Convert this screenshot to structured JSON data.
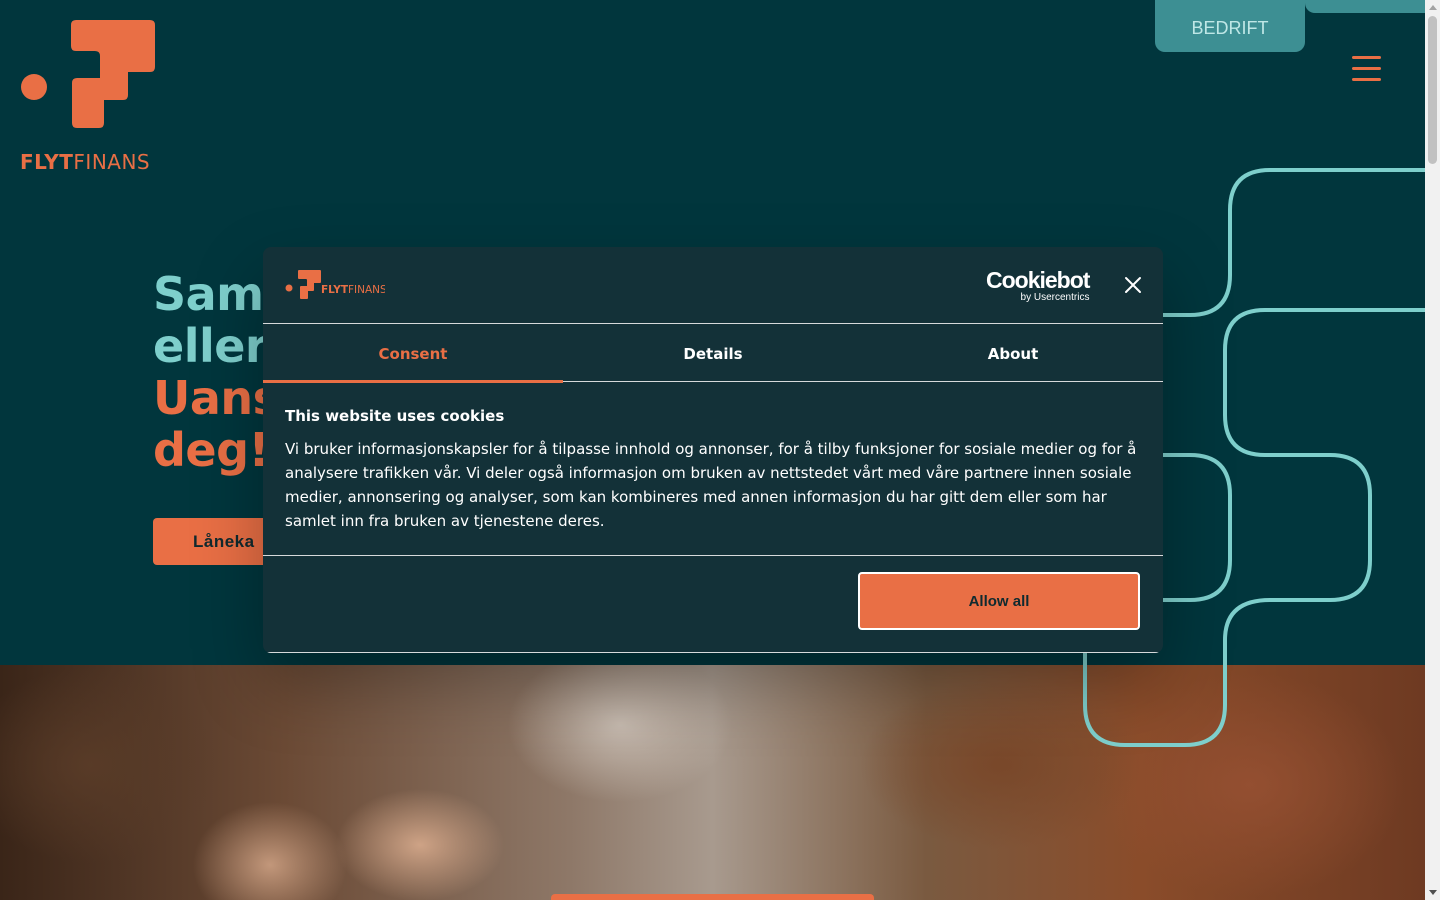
{
  "brand": {
    "logo_text_bold": "FLYT",
    "logo_text_regular": "FINANS",
    "accent_color": "#e96f45",
    "teal_color": "#7ecfcc",
    "background_color": "#01363d"
  },
  "header": {
    "bedrift_label": "BEDRIFT",
    "menu_icon": "hamburger-icon"
  },
  "hero": {
    "headline_line1": "Sam",
    "headline_line2": "eller",
    "headline_line3": "Uans",
    "headline_line4": "deg!",
    "cta_label": "Låneka"
  },
  "cookie_dialog": {
    "logo_text_bold": "FLYT",
    "logo_text_regular": "FINANS",
    "provider_name": "Cookiebot",
    "provider_sub": "by Usercentrics",
    "close_icon": "close-icon",
    "tabs": [
      {
        "label": "Consent",
        "active": true
      },
      {
        "label": "Details",
        "active": false
      },
      {
        "label": "About",
        "active": false
      }
    ],
    "title": "This website uses cookies",
    "text": "Vi bruker informasjonskapsler for å tilpasse innhold og annonser, for å tilby funksjoner for sosiale medier og for å analysere trafikken vår. Vi deler også informasjon om bruken av nettstedet vårt med våre partnere innen sosiale medier, annonsering og analyser, som kan kombineres med annen informasjon du har gitt dem eller som har samlet inn fra bruken av tjenestene deres.",
    "allow_all_label": "Allow all"
  }
}
